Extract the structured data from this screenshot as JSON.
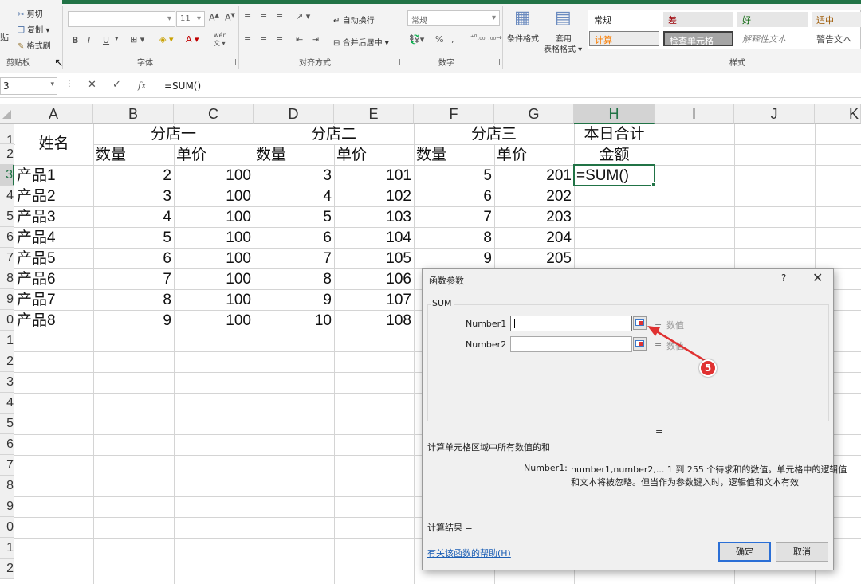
{
  "ribbon": {
    "clipboard": {
      "paste": "贴",
      "cut": "剪切",
      "copy": "复制",
      "format_painter": "格式刷",
      "label": "剪贴板"
    },
    "font": {
      "font_size": "11",
      "bold": "B",
      "italic": "I",
      "underline": "U",
      "font_color": "A",
      "wen": "wén",
      "label": "字体"
    },
    "alignment": {
      "wrap": "自动换行",
      "merge": "合并后居中",
      "label": "对齐方式"
    },
    "number": {
      "format": "常规",
      "percent": "%",
      "comma": ",",
      "label": "数字"
    },
    "styles": {
      "conditional": "条件格式",
      "table_a": "套用",
      "table_b": "表格格式",
      "cells": [
        "常规",
        "差",
        "好",
        "适中",
        "计算",
        "检查单元格",
        "解释性文本",
        "警告文本"
      ],
      "label": "样式"
    }
  },
  "formula_bar": {
    "name_box": "3",
    "fx": "fx",
    "cancel": "✕",
    "enter": "✓",
    "formula": "=SUM()"
  },
  "grid": {
    "columns": [
      "A",
      "B",
      "C",
      "D",
      "E",
      "F",
      "G",
      "H",
      "I",
      "J",
      "K"
    ],
    "selected_column": "H",
    "rows": [
      "1",
      "2",
      "3",
      "4",
      "5",
      "6",
      "7",
      "8",
      "9",
      "0",
      "1",
      "2",
      "3",
      "4",
      "5",
      "6",
      "7",
      "8",
      "9",
      "0",
      "1",
      "2"
    ],
    "header": {
      "name": "姓名",
      "store1": "分店一",
      "store2": "分店二",
      "store3": "分店三",
      "total": "本日合计",
      "qty": "数量",
      "price": "单价",
      "amount": "金额"
    },
    "data": [
      [
        "产品1",
        "2",
        "100",
        "3",
        "101",
        "5",
        "201",
        "=SUM()"
      ],
      [
        "产品2",
        "3",
        "100",
        "4",
        "102",
        "6",
        "202",
        ""
      ],
      [
        "产品3",
        "4",
        "100",
        "5",
        "103",
        "7",
        "203",
        ""
      ],
      [
        "产品4",
        "5",
        "100",
        "6",
        "104",
        "8",
        "204",
        ""
      ],
      [
        "产品5",
        "6",
        "100",
        "7",
        "105",
        "9",
        "205",
        ""
      ],
      [
        "产品6",
        "7",
        "100",
        "8",
        "106",
        "",
        "",
        ""
      ],
      [
        "产品7",
        "8",
        "100",
        "9",
        "107",
        "",
        "",
        ""
      ],
      [
        "产品8",
        "9",
        "100",
        "10",
        "108",
        "",
        "",
        ""
      ]
    ]
  },
  "dialog": {
    "title": "函数参数",
    "help": "?",
    "close": "✕",
    "function": "SUM",
    "args": [
      {
        "label": "Number1",
        "eq": "=",
        "value": "数值"
      },
      {
        "label": "Number2",
        "eq": "=",
        "value": "数值"
      }
    ],
    "result_eq": "=",
    "description": "计算单元格区域中所有数值的和",
    "arg_help_label": "Number1:",
    "arg_help_line1": "number1,number2,...  1 到 255 个待求和的数值。单元格中的逻辑值",
    "arg_help_line2": "和文本将被忽略。但当作为参数键入时，逻辑值和文本有效",
    "result_label": "计算结果 =",
    "help_link": "有关该函数的帮助(H)",
    "ok": "确定",
    "cancel": "取消"
  },
  "annotation": {
    "step": "5",
    "color": "#e03131"
  }
}
